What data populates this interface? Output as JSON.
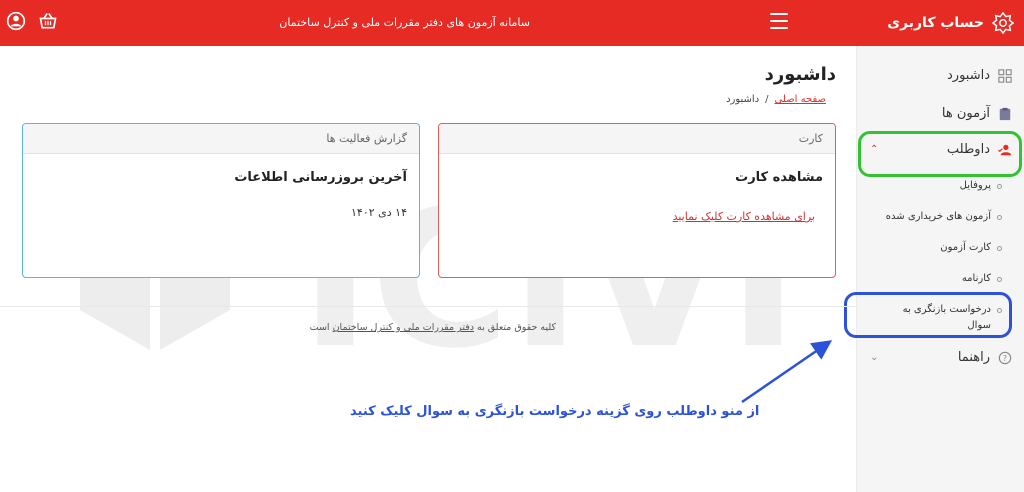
{
  "topbar": {
    "brand": "حساب کاربری",
    "system_title": "سامانه آزمون های دفتر مقررات ملی و کنترل ساختمان",
    "icons": [
      "brand-logo-icon",
      "menu-icon",
      "basket-icon",
      "user-icon"
    ]
  },
  "sidebar": {
    "items": [
      {
        "label": "داشبورد",
        "icon": "dashboard-icon"
      },
      {
        "label": "آزمون ها",
        "icon": "clipboard-icon"
      },
      {
        "label": "داوطلب",
        "icon": "user-check-icon",
        "expanded": true
      },
      {
        "label": "راهنما",
        "icon": "help-icon"
      }
    ],
    "subitems": [
      {
        "label": "پروفایل"
      },
      {
        "label": "آزمون های خریداری شده"
      },
      {
        "label": "کارت آزمون"
      },
      {
        "label": "کارنامه"
      },
      {
        "label": "درخواست بازنگری به سوال"
      }
    ]
  },
  "main": {
    "title": "داشبورد",
    "breadcrumb": {
      "home": "صفحه اصلی",
      "separator": "/",
      "current": "داشبورد"
    },
    "card_card": {
      "header": "کارت",
      "title": "مشاهده کارت",
      "link": "برای مشاهده کارت کلیک نمایید"
    },
    "card_activity": {
      "header": "گزارش فعالیت ها",
      "title": "آخرین بروزرسانی اطلاعات",
      "date": "۱۴ دی ۱۴۰۲"
    },
    "footer": {
      "prefix": "کلیه حقوق متعلق به",
      "link": "دفتر مقررات ملی و کنترل ساختمان",
      "suffix": "است"
    }
  },
  "annotation": "از منو داوطلب روی گزینه درخواست بازنگری به سوال کلیک کنید",
  "watermark": "ICIVIL",
  "colors": {
    "primary": "#e52b24",
    "highlight_green": "#33c234",
    "highlight_blue": "#2b52d8"
  }
}
